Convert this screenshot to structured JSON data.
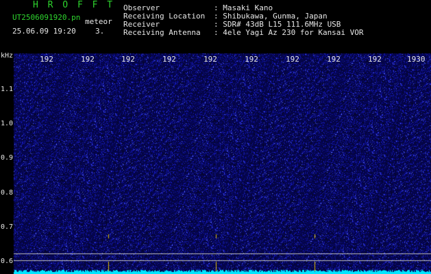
{
  "header": {
    "logo": "H R O F F T",
    "file": "UT2506091920.pn",
    "type": "meteor",
    "datetime": "25.06.09 19:20",
    "counter": "3.",
    "rows": [
      {
        "label": "Observer",
        "value": ": Masaki Kano"
      },
      {
        "label": "Receiving Location",
        "value": ": Shibukawa, Gunma, Japan"
      },
      {
        "label": "Receiver",
        "value": ": SDR# 43dB L15 111.6MHz USB"
      },
      {
        "label": "Receiving Antenna",
        "value": ": 4ele Yagi Az 230 for Kansai VOR"
      }
    ]
  },
  "axis": {
    "y_unit": "kHz",
    "y_ticks": [
      "1.1",
      "1.0",
      "0.9",
      "0.8",
      "0.7",
      "0.6"
    ],
    "x_ticks": [
      "192",
      "192",
      "192",
      "192",
      "192",
      "192",
      "192",
      "192",
      "192",
      "1930"
    ]
  },
  "colors": {
    "background": "#000000",
    "noise_dark": "#0a0a40",
    "noise_mid": "#1b1bb0",
    "noise_bright": "#4a5cff",
    "baseline": "#00e5ff",
    "marker": "#e0c000"
  }
}
